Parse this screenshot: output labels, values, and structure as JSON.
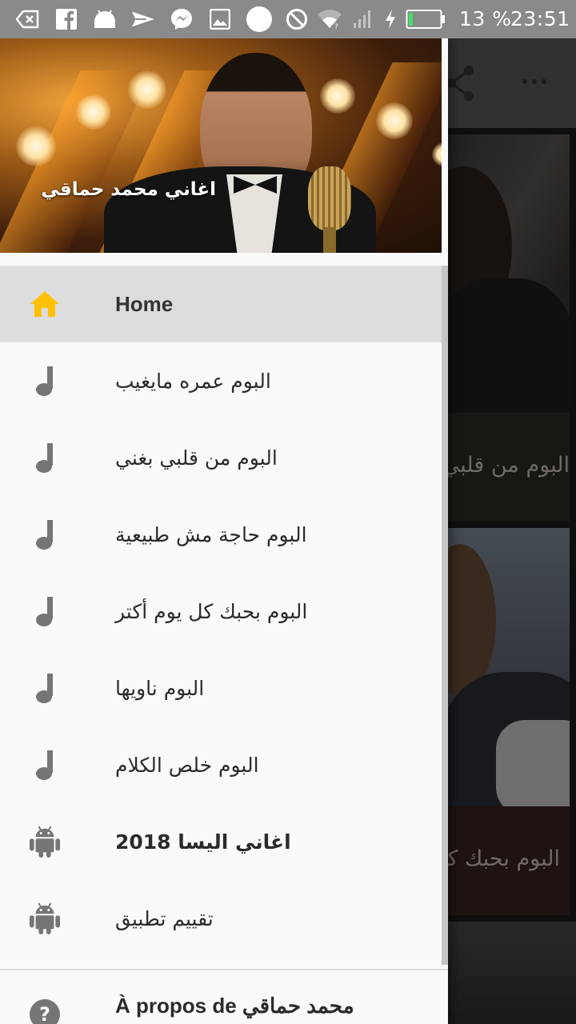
{
  "status_bar": {
    "battery_percent": "13 %",
    "time": "23:51",
    "battery_level": 0.13,
    "icons": [
      "back-arrow-icon",
      "facebook-icon",
      "android-icon",
      "send-icon",
      "messenger-icon",
      "image-icon",
      "circle-icon",
      "block-icon",
      "wifi-icon",
      "signal-icon",
      "charging-icon",
      "battery-icon"
    ]
  },
  "background_app": {
    "toolbar_icons": [
      "share-icon",
      "more-vert-icon"
    ],
    "cards": [
      {
        "caption": "البوم من قلبي بغني"
      },
      {
        "caption": "البوم بحبك كل يوم أكتر"
      }
    ]
  },
  "drawer": {
    "header_title": "اغاني محمد حماقي",
    "items": [
      {
        "label": "Home",
        "icon": "home-icon",
        "active": true
      },
      {
        "label": "البوم عمره مايغيب",
        "icon": "music-note-icon"
      },
      {
        "label": "البوم من قلبي بغني",
        "icon": "music-note-icon"
      },
      {
        "label": "البوم حاجة مش طبيعية",
        "icon": "music-note-icon"
      },
      {
        "label": "البوم بحبك كل يوم أكتر",
        "icon": "music-note-icon"
      },
      {
        "label": "البوم ناويها",
        "icon": "music-note-icon"
      },
      {
        "label": "البوم خلص الكلام",
        "icon": "music-note-icon"
      },
      {
        "label": "اغاني اليسا 2018",
        "icon": "android-icon"
      },
      {
        "label": "تقييم تطبيق",
        "icon": "android-icon"
      }
    ],
    "about_label": "À propos de  محمد حماقي",
    "colors": {
      "accent": "#FFC107",
      "active_bg": "#DDDDDD",
      "icon": "#757575"
    }
  }
}
